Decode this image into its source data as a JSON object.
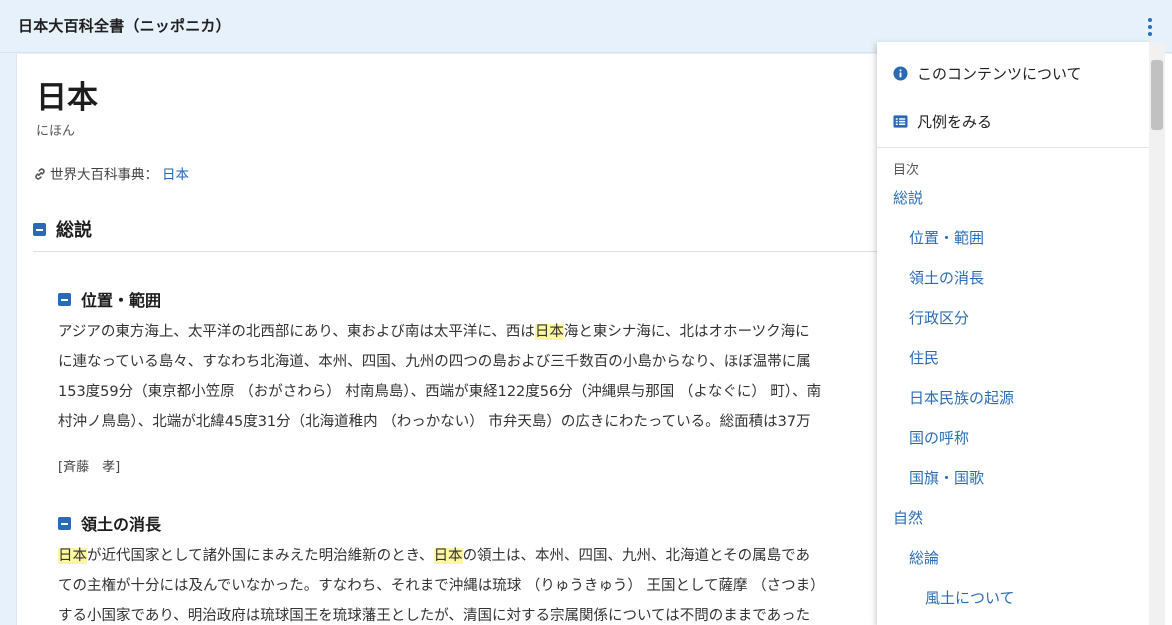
{
  "app": {
    "title": "日本大百科全書（ニッポニカ）"
  },
  "article": {
    "title": "日本",
    "reading": "にほん",
    "reference": {
      "label": "世界大百科事典：",
      "link_text": "日本"
    },
    "section": {
      "title": "総説"
    },
    "subsections": [
      {
        "title": "位置・範囲",
        "lines": [
          [
            "アジアの東方海上、太平洋の北西部にあり、東および南は太平洋に、西は",
            {
              "hl": "日本"
            },
            "海と東シナ海に、北はオホーツク海に"
          ],
          [
            "に連なっている島々、すなわち北海道、本州、四国、九州の四つの島および三千数百の小島からなり、ほぼ温帯に属"
          ],
          [
            "153度59分（東京都小笠原 （おがさわら） 村南鳥島）、西端が東経122度56分（沖縄県与那国 （よなぐに） 町）、南"
          ],
          [
            "村沖ノ鳥島）、北端が北緯45度31分（北海道稚内 （わっかない） 市弁天島）の広きにわたっている。総面積は37万"
          ]
        ],
        "author": "[斉藤　孝]"
      },
      {
        "title": "領土の消長",
        "lines": [
          [
            {
              "hl": "日本"
            },
            "が近代国家として諸外国にまみえた明治維新のとき、",
            {
              "hl": "日本"
            },
            "の領土は、本州、四国、九州、北海道とその属島であ"
          ],
          [
            "ての主権が十分には及んでいなかった。すなわち、それまで沖縄は琉球 （りゅうきゅう） 王国として薩摩 （さつま）"
          ],
          [
            "する小国家であり、明治政府は琉球国王を琉球藩王としたが、清国に対する宗属関係については不問のままであった"
          ]
        ]
      }
    ]
  },
  "menu": {
    "about_label": "このコンテンツについて",
    "legend_label": "凡例をみる",
    "toc_label": "目次",
    "toc": [
      {
        "label": "総説",
        "level": 1
      },
      {
        "label": "位置・範囲",
        "level": 2
      },
      {
        "label": "領土の消長",
        "level": 2
      },
      {
        "label": "行政区分",
        "level": 2
      },
      {
        "label": "住民",
        "level": 2
      },
      {
        "label": "日本民族の起源",
        "level": 2
      },
      {
        "label": "国の呼称",
        "level": 2
      },
      {
        "label": "国旗・国歌",
        "level": 2
      },
      {
        "label": "自然",
        "level": 1
      },
      {
        "label": "総論",
        "level": 2
      },
      {
        "label": "風土について",
        "level": 3
      }
    ]
  },
  "colors": {
    "accent": "#2a69b5",
    "link": "#2b6db5",
    "highlight": "#fff7a0",
    "topbar": "#e7f1fb"
  },
  "icons": {
    "about": "info-icon",
    "legend": "list-icon",
    "reference": "link-icon",
    "collapse": "minus-box-icon",
    "more": "kebab-icon"
  }
}
